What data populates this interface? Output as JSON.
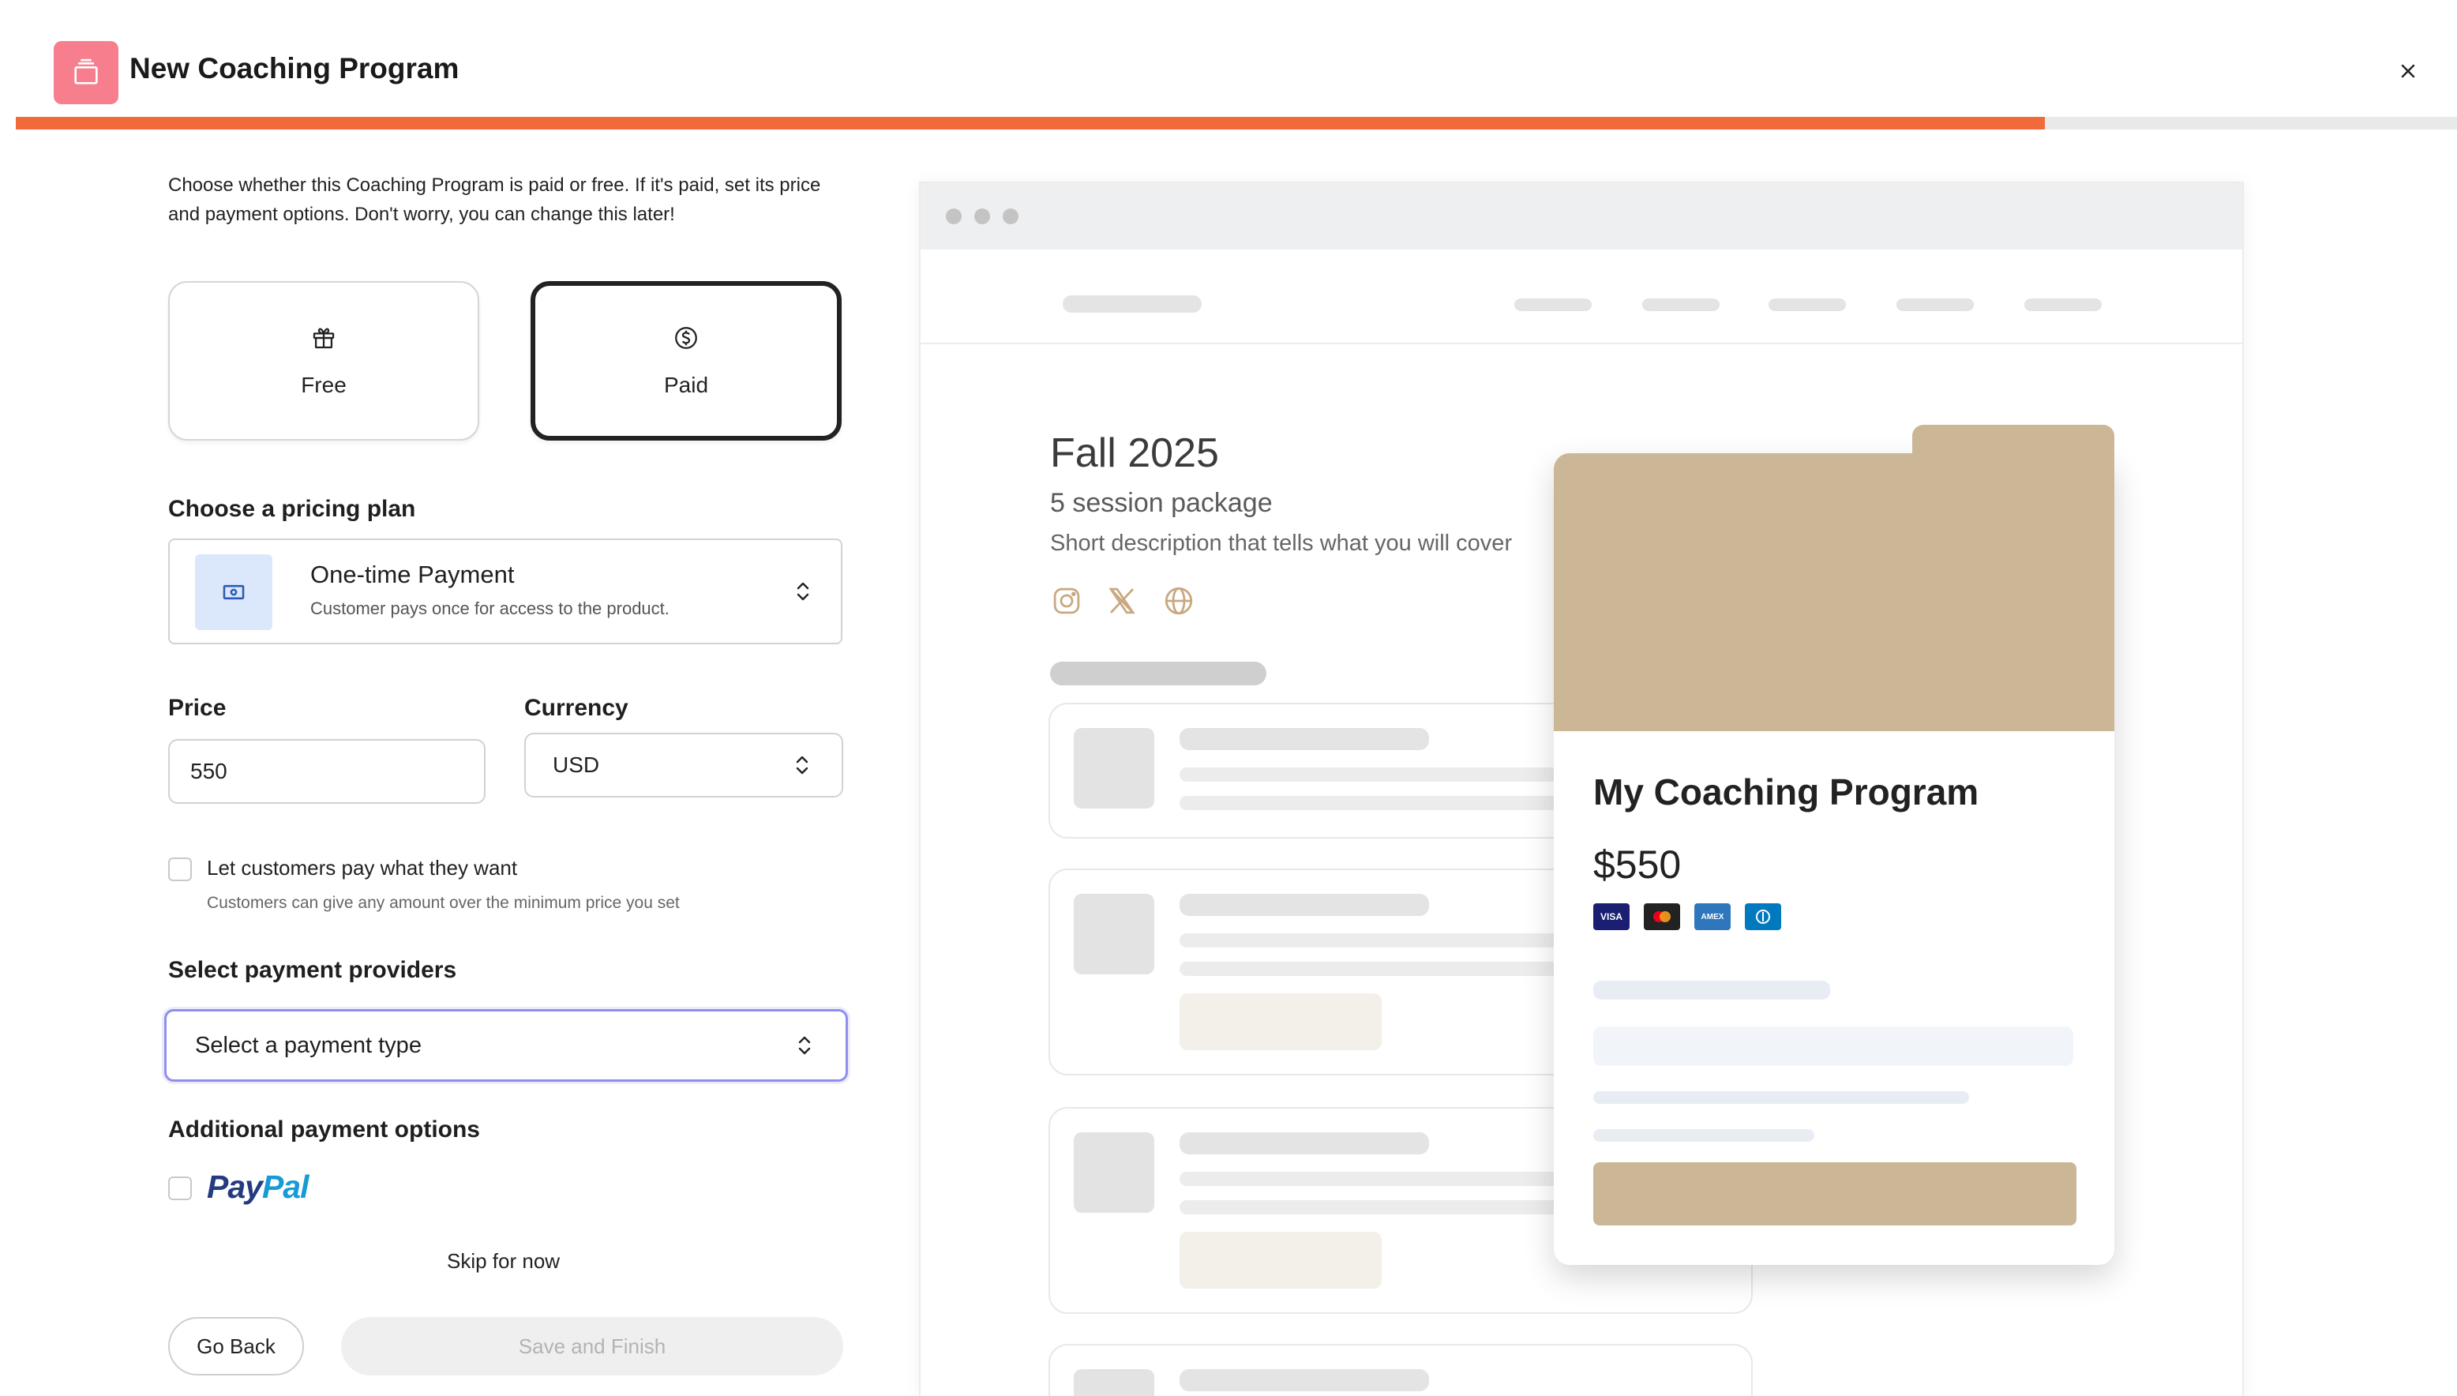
{
  "header": {
    "title": "New Coaching Program",
    "progress_fraction": 0.83,
    "colors": {
      "accent": "#f26a3a",
      "app_icon": "#f77e8d"
    }
  },
  "form": {
    "intro": "Choose whether this Coaching Program is paid or free. If it's paid, set its price and payment options. Don't worry, you can change this later!",
    "options": [
      {
        "label": "Free",
        "icon": "gift-icon",
        "selected": false
      },
      {
        "label": "Paid",
        "icon": "dollar-circle-icon",
        "selected": true
      }
    ],
    "pricing_plan": {
      "label": "Choose a pricing plan",
      "title": "One-time Payment",
      "description": "Customer pays once for access to the product."
    },
    "price": {
      "label": "Price",
      "value": "550"
    },
    "currency": {
      "label": "Currency",
      "value": "USD"
    },
    "pwyw": {
      "label": "Let customers pay what they want",
      "description": "Customers can give any amount over the minimum price you set",
      "checked": false
    },
    "payment_providers": {
      "label": "Select payment providers",
      "placeholder": "Select a payment type"
    },
    "additional": {
      "label": "Additional payment options",
      "paypal_pay": "Pay",
      "paypal_pal": "Pal",
      "checked": false
    },
    "skip": "Skip for now",
    "back": "Go Back",
    "save": "Save and Finish"
  },
  "preview": {
    "title": "Fall 2025",
    "subtitle": "5 session package",
    "description": "Short description that tells what you will cover",
    "social_icons": [
      "instagram-icon",
      "x-icon",
      "globe-icon"
    ],
    "card": {
      "title": "My Coaching Program",
      "price": "$550",
      "payment_icons": [
        "visa-icon",
        "mastercard-icon",
        "amex-icon",
        "diners-icon"
      ],
      "cover_color": "#cbb796",
      "visa_text": "VISA",
      "amex_text": "AMEX"
    }
  }
}
